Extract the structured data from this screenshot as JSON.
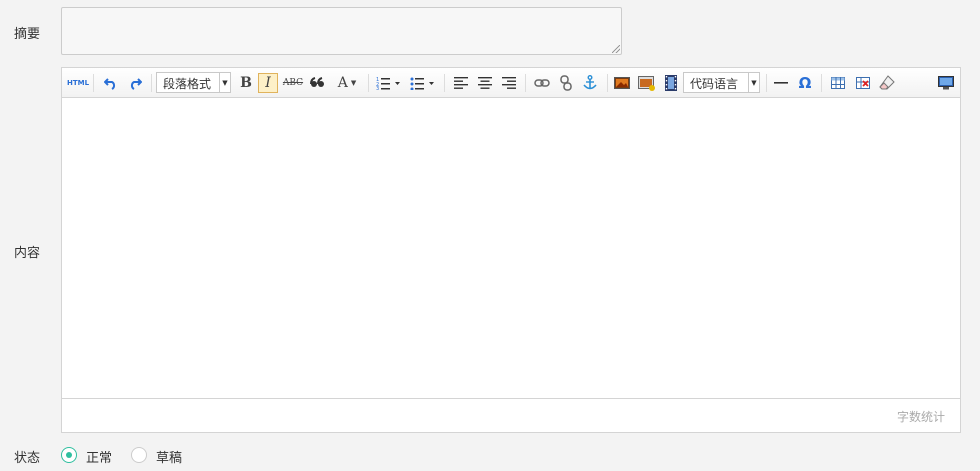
{
  "form": {
    "summary_label": "摘要",
    "summary_value": "",
    "content_label": "内容",
    "status_label": "状态"
  },
  "toolbar": {
    "html_label": "HTML",
    "paragraph_format": "段落格式",
    "bold": "B",
    "italic": "I",
    "strikethrough": "ABC",
    "font_color": "A",
    "code_language": "代码语言"
  },
  "editor": {
    "word_count": "字数统计"
  },
  "status": {
    "options": [
      {
        "label": "正常",
        "selected": true
      },
      {
        "label": "草稿",
        "selected": false
      }
    ]
  },
  "colors": {
    "accent": "#2fbf9f",
    "undo": "#2a6fd6",
    "background": "#f3f3f3"
  }
}
